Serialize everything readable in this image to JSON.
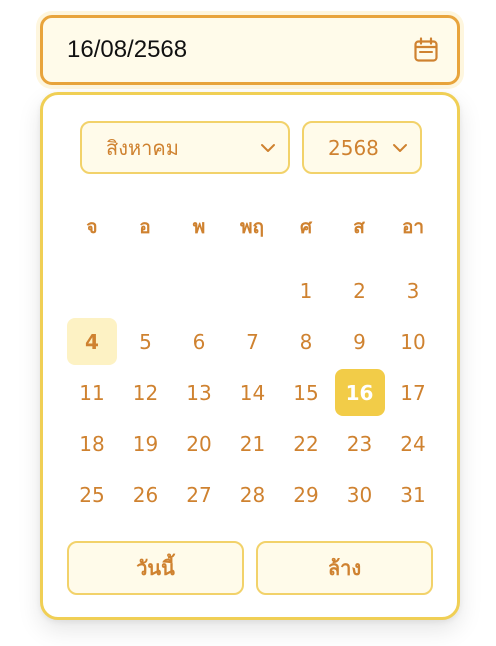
{
  "date_input": {
    "value": "16/08/2568",
    "icon": "calendar-icon"
  },
  "picker": {
    "month": "สิงหาคม",
    "year": "2568",
    "weekdays": [
      "จ",
      "อ",
      "พ",
      "พฤ",
      "ศ",
      "ส",
      "อา"
    ],
    "first_weekday_index": 4,
    "days_in_month": 31,
    "today_day": 4,
    "selected_day": 16,
    "days": [
      "1",
      "2",
      "3",
      "4",
      "5",
      "6",
      "7",
      "8",
      "9",
      "10",
      "11",
      "12",
      "13",
      "14",
      "15",
      "16",
      "17",
      "18",
      "19",
      "20",
      "21",
      "22",
      "23",
      "24",
      "25",
      "26",
      "27",
      "28",
      "29",
      "30",
      "31"
    ],
    "today_button": "วันนี้",
    "clear_button": "ล้าง"
  },
  "colors": {
    "accent": "#e8a43c",
    "text": "#cf8230",
    "selected_bg": "#f2cc48",
    "today_bg": "#fdf2c4",
    "field_bg": "#fffbea"
  }
}
